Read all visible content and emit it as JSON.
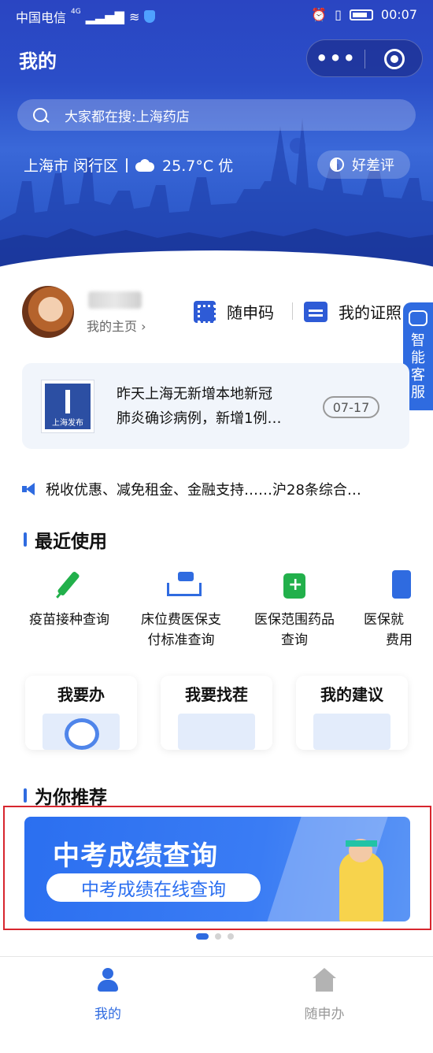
{
  "status_bar": {
    "carrier": "中国电信",
    "network": "4G",
    "time": "00:07"
  },
  "header": {
    "title": "我的"
  },
  "search": {
    "placeholder": "大家都在搜:上海药店"
  },
  "location": {
    "city": "上海市 闵行区",
    "weather": "25.7°C 优"
  },
  "rating_button": "好差评",
  "profile": {
    "homepage_label": "我的主页 ›"
  },
  "quick_actions": {
    "code": "随申码",
    "certificates": "我的证照"
  },
  "customer_service": [
    "智",
    "能",
    "客",
    "服"
  ],
  "news": {
    "logo_text": "上海发布",
    "headline_line1": "昨天上海无新增本地新冠",
    "headline_line2": "肺炎确诊病例，新增1例…",
    "date": "07-17"
  },
  "ticker": {
    "text": "税收优惠、减免租金、金融支持……沪28条综合…"
  },
  "recent": {
    "title": "最近使用",
    "items": [
      {
        "line1": "疫苗接种查询",
        "line2": ""
      },
      {
        "line1": "床位费医保支",
        "line2": "付标准查询"
      },
      {
        "line1": "医保范围药品",
        "line2": "查询"
      },
      {
        "line1": "医保就",
        "line2": "费用"
      }
    ]
  },
  "cards": [
    {
      "label": "我要办"
    },
    {
      "label": "我要找茬"
    },
    {
      "label": "我的建议"
    }
  ],
  "recommend": {
    "title": "为你推荐",
    "banner_title": "中考成绩查询",
    "banner_subtitle": "中考成绩在线查询"
  },
  "tab_bar": {
    "items": [
      {
        "label": "我的",
        "color": "#2f6be0"
      },
      {
        "label": "随申办",
        "color": "#999999"
      }
    ]
  },
  "colors": {
    "brand_blue": "#2f6be0",
    "highlight_red": "#d7262e"
  }
}
